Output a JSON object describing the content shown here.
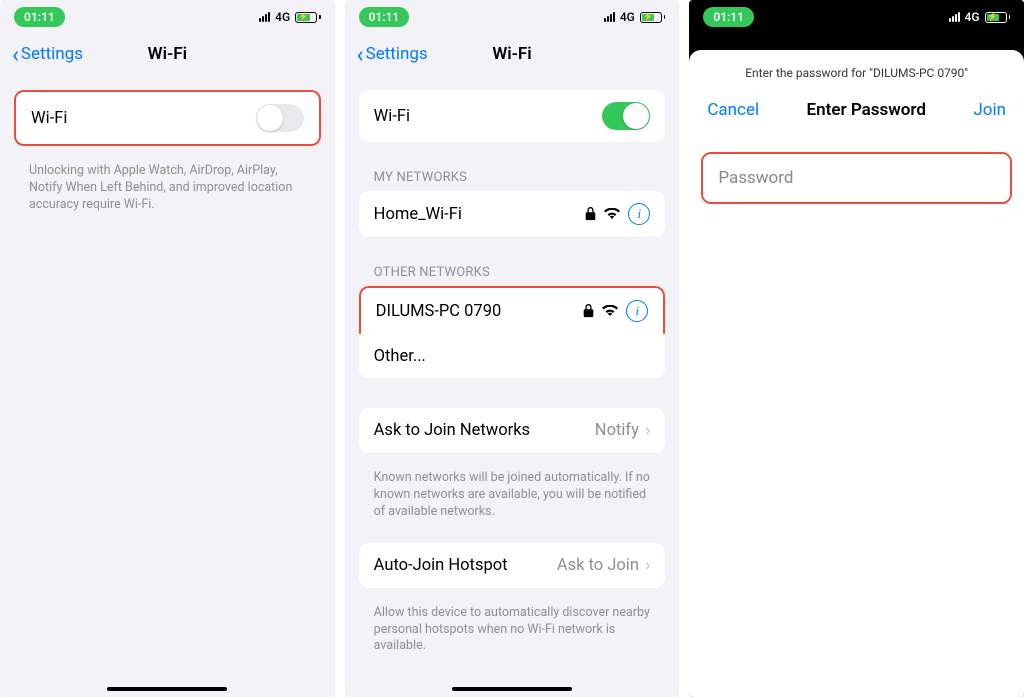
{
  "status": {
    "time": "01:11",
    "network_type": "4G"
  },
  "screen1": {
    "back_label": "Settings",
    "title": "Wi-Fi",
    "wifi_label": "Wi-Fi",
    "wifi_on": false,
    "footer": "Unlocking with Apple Watch, AirDrop, AirPlay, Notify When Left Behind, and improved location accuracy require Wi-Fi."
  },
  "screen2": {
    "back_label": "Settings",
    "title": "Wi-Fi",
    "wifi_label": "Wi-Fi",
    "wifi_on": true,
    "my_networks_label": "MY NETWORKS",
    "my_networks": [
      {
        "name": "Home_Wi-Fi"
      }
    ],
    "other_networks_label": "OTHER NETWORKS",
    "other_networks": [
      {
        "name": "DILUMS-PC 0790"
      }
    ],
    "other_label": "Other...",
    "ask_to_join": {
      "label": "Ask to Join Networks",
      "value": "Notify",
      "footer": "Known networks will be joined automatically. If no known networks are available, you will be notified of available networks."
    },
    "auto_join": {
      "label": "Auto-Join Hotspot",
      "value": "Ask to Join",
      "footer": "Allow this device to automatically discover nearby personal hotspots when no Wi-Fi network is available."
    }
  },
  "screen3": {
    "subtitle": "Enter the password for \"DILUMS-PC 0790\"",
    "cancel": "Cancel",
    "title": "Enter Password",
    "join": "Join",
    "password_placeholder": "Password"
  }
}
